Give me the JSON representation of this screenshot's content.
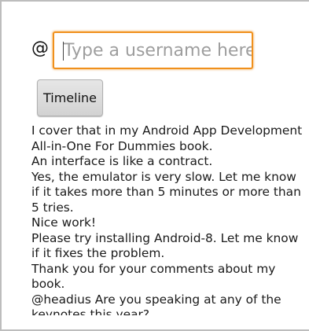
{
  "username_field": {
    "prefix": "@",
    "placeholder": "Type a username here"
  },
  "timeline_button": {
    "label": "Timeline"
  },
  "tweets": [
    "I cover that in my Android App Development All-in-One For Dummies book.",
    "An interface is like a contract.",
    "Yes, the emulator is very slow. Let me know if it takes more than 5 minutes or more than 5 tries.",
    "Nice work!",
    "Please try installing Android-8. Let me know if it fixes the problem.",
    "Thank you for your comments about my book.",
    "@headius Are you speaking at any of the keynotes this year?"
  ],
  "colors": {
    "input_focus_border": "#f0901c",
    "placeholder_text": "#9e9e9e"
  }
}
